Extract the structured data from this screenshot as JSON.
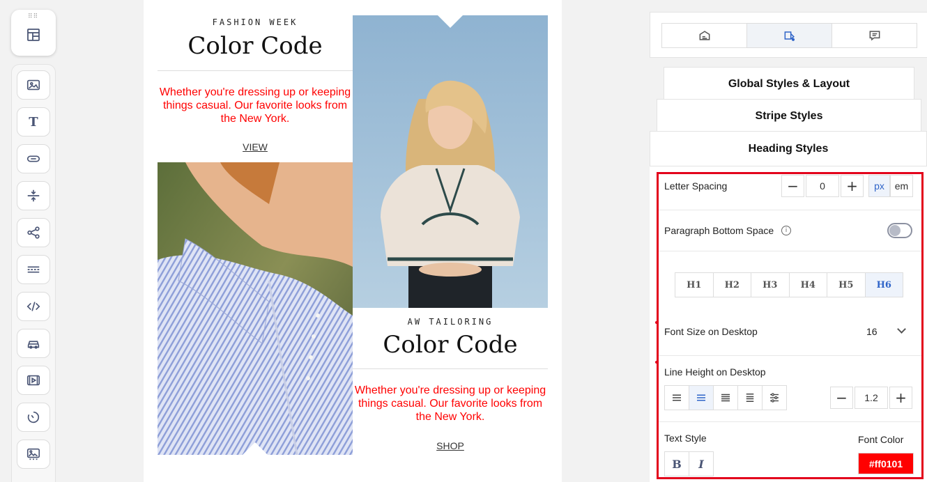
{
  "email": {
    "left": {
      "eyebrow": "FASHION WEEK",
      "heading": "Color Code",
      "paragraph": "Whether you're dressing up or keeping things casual. Our favorite looks from the New York.",
      "link": "VIEW"
    },
    "right": {
      "eyebrow": "AW TAILORING",
      "heading": "Color Code",
      "paragraph": "Whether you're dressing up or keeping things casual. Our favorite looks from the New York.",
      "link": "SHOP"
    },
    "text_color": "#ff0101"
  },
  "toolbar": {
    "items": [
      "image-icon",
      "text-icon",
      "button-icon",
      "spacer-icon",
      "share-icon",
      "divider-icon",
      "html-icon",
      "car-icon",
      "video-icon",
      "timer-icon",
      "gallery-icon"
    ],
    "text_letter": "T"
  },
  "panel": {
    "tabs": [
      "content-tab",
      "styles-tab",
      "comments-tab"
    ],
    "active_tab": "styles-tab",
    "sections": {
      "global": "Global Styles & Layout",
      "stripe": "Stripe Styles",
      "heading": "Heading Styles"
    },
    "letter_spacing": {
      "label": "Letter Spacing",
      "minus": "−",
      "value": "0",
      "plus": "+",
      "units": [
        "px",
        "em"
      ],
      "active_unit": "px"
    },
    "paragraph_bottom_space": {
      "label": "Paragraph Bottom Space",
      "info": "i",
      "enabled": false
    },
    "heading_levels": [
      "H1",
      "H2",
      "H3",
      "H4",
      "H5",
      "H6"
    ],
    "active_heading": "H6",
    "font_size": {
      "label": "Font Size on Desktop",
      "value": "16"
    },
    "line_height": {
      "label": "Line Height on Desktop",
      "minus": "−",
      "value": "1.2",
      "plus": "+",
      "alignments": [
        "align-left-icon",
        "align-center-icon",
        "align-right-icon",
        "align-justify-icon",
        "custom-settings-icon"
      ],
      "active_alignment": "align-center-icon"
    },
    "text_style": {
      "label": "Text Style",
      "bold": "B",
      "italic": "I"
    },
    "font_color": {
      "label": "Font Color",
      "value": "#ff0101"
    }
  },
  "colors": {
    "accent": "#2f64c8",
    "highlight_frame": "#e3001b"
  }
}
